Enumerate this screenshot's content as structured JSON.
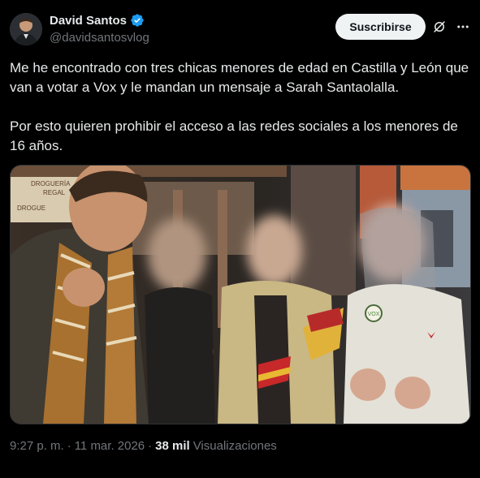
{
  "author": {
    "name": "David Santos",
    "handle": "@davidsantosvlog"
  },
  "actions": {
    "subscribe_label": "Suscribirse"
  },
  "tweet": {
    "text": "Me he encontrado con tres chicas menores de edad en Castilla y León que van a votar a Vox y le mandan un mensaje a Sarah Santaolalla.\n\nPor esto quieren prohibir el acceso a las redes sociales a los menores de 16 años.",
    "media_sign_text": [
      "DROGUERÍA",
      "REGAL",
      "DROGUE"
    ],
    "badge_text": "VOX"
  },
  "meta": {
    "time": "9:27 p. m.",
    "separator1": "·",
    "date": "11 mar. 2026",
    "separator2": "·",
    "views_count": "38 mil",
    "views_label": "Visualizaciones"
  },
  "icons": {
    "verified": "verified-badge-icon",
    "grok": "grok-icon",
    "more": "more-options-icon"
  },
  "colors": {
    "background": "#000000",
    "text": "#e7e9ea",
    "secondary_text": "#71767b",
    "verified_blue": "#1d9bf0",
    "button_bg": "#eff3f4"
  }
}
